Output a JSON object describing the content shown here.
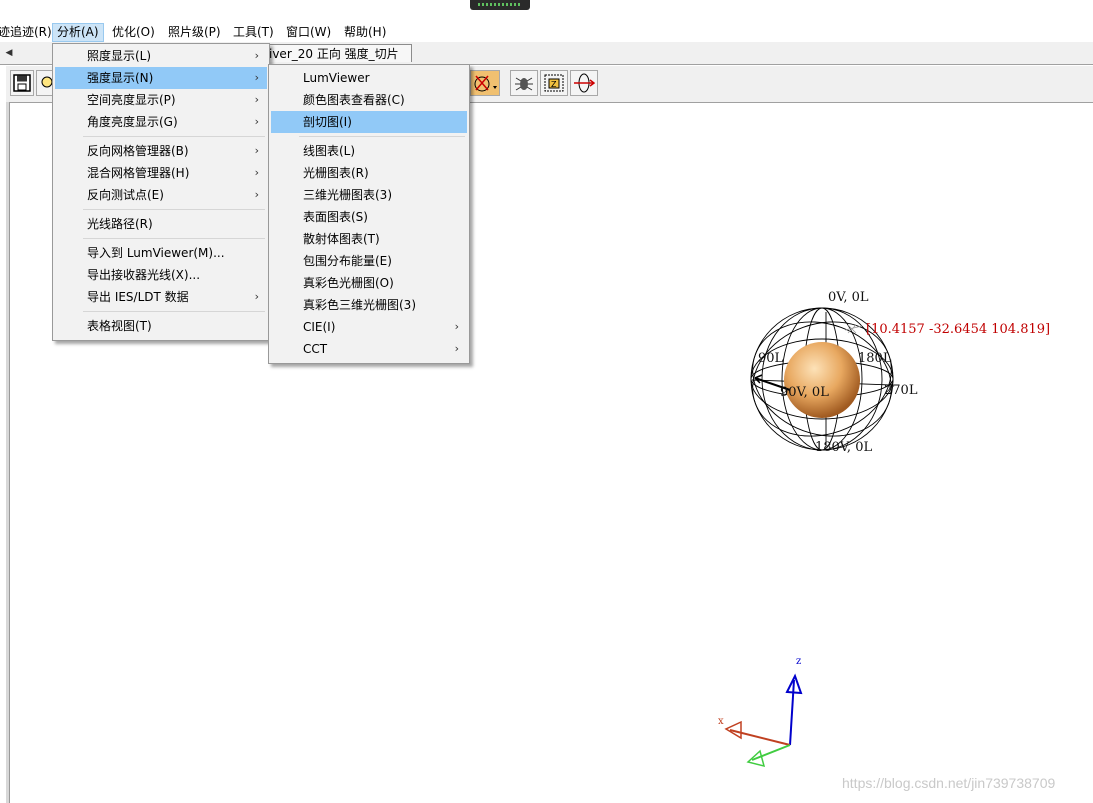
{
  "menubar": {
    "items": [
      {
        "label": "迹追迹(R)"
      },
      {
        "label": "分析(A)"
      },
      {
        "label": "优化(O)"
      },
      {
        "label": "照片级(P)"
      },
      {
        "label": "工具(T)"
      },
      {
        "label": "窗口(W)"
      },
      {
        "label": "帮助(H)"
      }
    ]
  },
  "document_tab": {
    "title": "iver_20 正向 强度_切片"
  },
  "analysis_menu": {
    "items": [
      {
        "label": "照度显示(L)"
      },
      {
        "label": "强度显示(N)"
      },
      {
        "label": "空间亮度显示(P)"
      },
      {
        "label": "角度亮度显示(G)"
      },
      {
        "label": "反向网格管理器(B)"
      },
      {
        "label": "混合网格管理器(H)"
      },
      {
        "label": "反向测试点(E)"
      },
      {
        "label": "光线路径(R)"
      },
      {
        "label": "导入到 LumViewer(M)..."
      },
      {
        "label": "导出接收器光线(X)..."
      },
      {
        "label": "导出 IES/LDT 数据"
      },
      {
        "label": "表格视图(T)"
      }
    ]
  },
  "intensity_submenu": {
    "items": [
      {
        "label": "LumViewer"
      },
      {
        "label": "颜色图表查看器(C)"
      },
      {
        "label": "剖切图(I)"
      },
      {
        "label": "线图表(L)"
      },
      {
        "label": "光栅图表(R)"
      },
      {
        "label": "三维光栅图表(3)"
      },
      {
        "label": "表面图表(S)"
      },
      {
        "label": "散射体图表(T)"
      },
      {
        "label": "包围分布能量(E)"
      },
      {
        "label": "真彩色光栅图(O)"
      },
      {
        "label": "真彩色三维光栅图(3)"
      },
      {
        "label": "CIE(I)"
      },
      {
        "label": "CCT"
      }
    ]
  },
  "scene": {
    "labels": {
      "top": "0V,  0L",
      "left": "90L",
      "right": "180L",
      "far_right": "270L",
      "center": "90V, 0L",
      "bottom": "180V,  0L"
    },
    "coord_readout": "[10.4157 -32.6454 104.819]",
    "axes": {
      "z": "z",
      "x": "x"
    }
  },
  "watermark": "https://blog.csdn.net/jin739738709",
  "colors": {
    "menu_highlight": "#91c9f7",
    "menubar_active": "#cce4f7",
    "readout": "#c00000",
    "sphere": "#e8a860",
    "axis_z": "#0000cc",
    "axis_x": "#c04020",
    "axis_y": "#40cc40"
  },
  "icons": [
    "save-icon",
    "search-icon",
    "ray-trace-icon",
    "bug-icon",
    "z-clip-icon",
    "rotate-view-icon"
  ]
}
